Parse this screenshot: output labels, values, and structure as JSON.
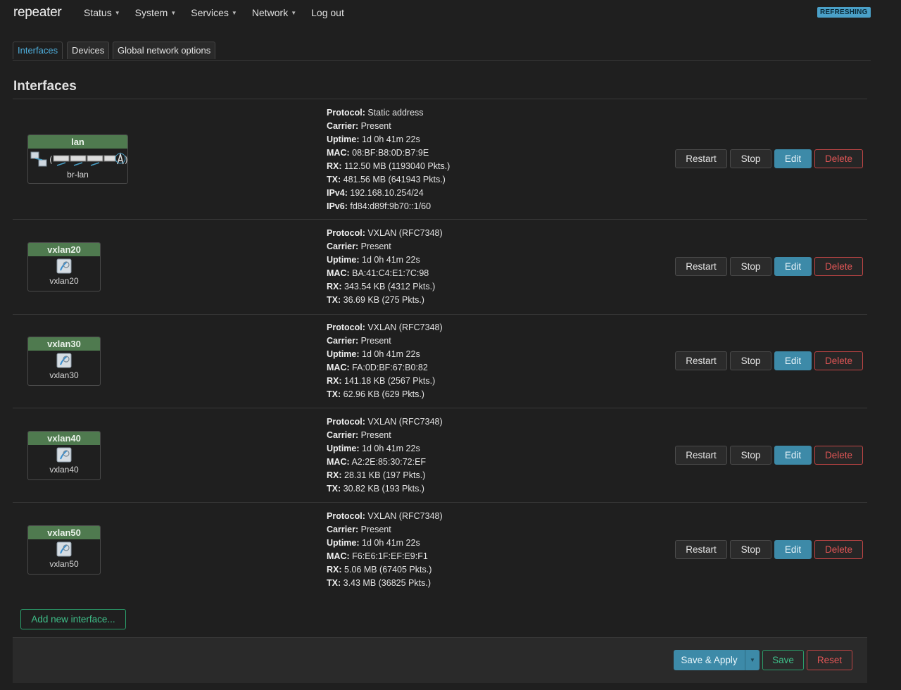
{
  "header": {
    "brand": "repeater",
    "menu": [
      {
        "label": "Status",
        "has_caret": true
      },
      {
        "label": "System",
        "has_caret": true
      },
      {
        "label": "Services",
        "has_caret": true
      },
      {
        "label": "Network",
        "has_caret": true
      },
      {
        "label": "Log out",
        "has_caret": false
      }
    ],
    "status_badge": "REFRESHING"
  },
  "tabs": [
    {
      "label": "Interfaces",
      "active": true
    },
    {
      "label": "Devices",
      "active": false
    },
    {
      "label": "Global network options",
      "active": false
    }
  ],
  "section_title": "Interfaces",
  "interfaces": [
    {
      "name": "lan",
      "device": "br-lan",
      "icon": "bridge-ports-icon",
      "info": [
        {
          "k": "Protocol:",
          "v": "Static address"
        },
        {
          "k": "Carrier:",
          "v": "Present"
        },
        {
          "k": "Uptime:",
          "v": "1d 0h 41m 22s"
        },
        {
          "k": "MAC:",
          "v": "08:BF:B8:0D:B7:9E"
        },
        {
          "k": "RX:",
          "v": "112.50 MB (1193040 Pkts.)"
        },
        {
          "k": "TX:",
          "v": "481.56 MB (641943 Pkts.)"
        },
        {
          "k": "IPv4:",
          "v": "192.168.10.254/24"
        },
        {
          "k": "IPv6:",
          "v": "fd84:d89f:9b70::1/60"
        }
      ]
    },
    {
      "name": "vxlan20",
      "device": "vxlan20",
      "icon": "tunnel-icon",
      "info": [
        {
          "k": "Protocol:",
          "v": "VXLAN (RFC7348)"
        },
        {
          "k": "Carrier:",
          "v": "Present"
        },
        {
          "k": "Uptime:",
          "v": "1d 0h 41m 22s"
        },
        {
          "k": "MAC:",
          "v": "BA:41:C4:E1:7C:98"
        },
        {
          "k": "RX:",
          "v": "343.54 KB (4312 Pkts.)"
        },
        {
          "k": "TX:",
          "v": "36.69 KB (275 Pkts.)"
        }
      ]
    },
    {
      "name": "vxlan30",
      "device": "vxlan30",
      "icon": "tunnel-icon",
      "info": [
        {
          "k": "Protocol:",
          "v": "VXLAN (RFC7348)"
        },
        {
          "k": "Carrier:",
          "v": "Present"
        },
        {
          "k": "Uptime:",
          "v": "1d 0h 41m 22s"
        },
        {
          "k": "MAC:",
          "v": "FA:0D:BF:67:B0:82"
        },
        {
          "k": "RX:",
          "v": "141.18 KB (2567 Pkts.)"
        },
        {
          "k": "TX:",
          "v": "62.96 KB (629 Pkts.)"
        }
      ]
    },
    {
      "name": "vxlan40",
      "device": "vxlan40",
      "icon": "tunnel-icon",
      "info": [
        {
          "k": "Protocol:",
          "v": "VXLAN (RFC7348)"
        },
        {
          "k": "Carrier:",
          "v": "Present"
        },
        {
          "k": "Uptime:",
          "v": "1d 0h 41m 22s"
        },
        {
          "k": "MAC:",
          "v": "A2:2E:85:30:72:EF"
        },
        {
          "k": "RX:",
          "v": "28.31 KB (197 Pkts.)"
        },
        {
          "k": "TX:",
          "v": "30.82 KB (193 Pkts.)"
        }
      ]
    },
    {
      "name": "vxlan50",
      "device": "vxlan50",
      "icon": "tunnel-icon",
      "info": [
        {
          "k": "Protocol:",
          "v": "VXLAN (RFC7348)"
        },
        {
          "k": "Carrier:",
          "v": "Present"
        },
        {
          "k": "Uptime:",
          "v": "1d 0h 41m 22s"
        },
        {
          "k": "MAC:",
          "v": "F6:E6:1F:EF:E9:F1"
        },
        {
          "k": "RX:",
          "v": "5.06 MB (67405 Pkts.)"
        },
        {
          "k": "TX:",
          "v": "3.43 MB (36825 Pkts.)"
        }
      ]
    }
  ],
  "row_actions": {
    "restart": "Restart",
    "stop": "Stop",
    "edit": "Edit",
    "delete": "Delete"
  },
  "add_interface_label": "Add new interface...",
  "footer": {
    "save_apply": "Save & Apply",
    "save": "Save",
    "reset": "Reset"
  },
  "colors": {
    "accent": "#3d8aa8",
    "success": "#3fc08a",
    "danger": "#e05555",
    "iface_header": "#4f7a4f"
  }
}
